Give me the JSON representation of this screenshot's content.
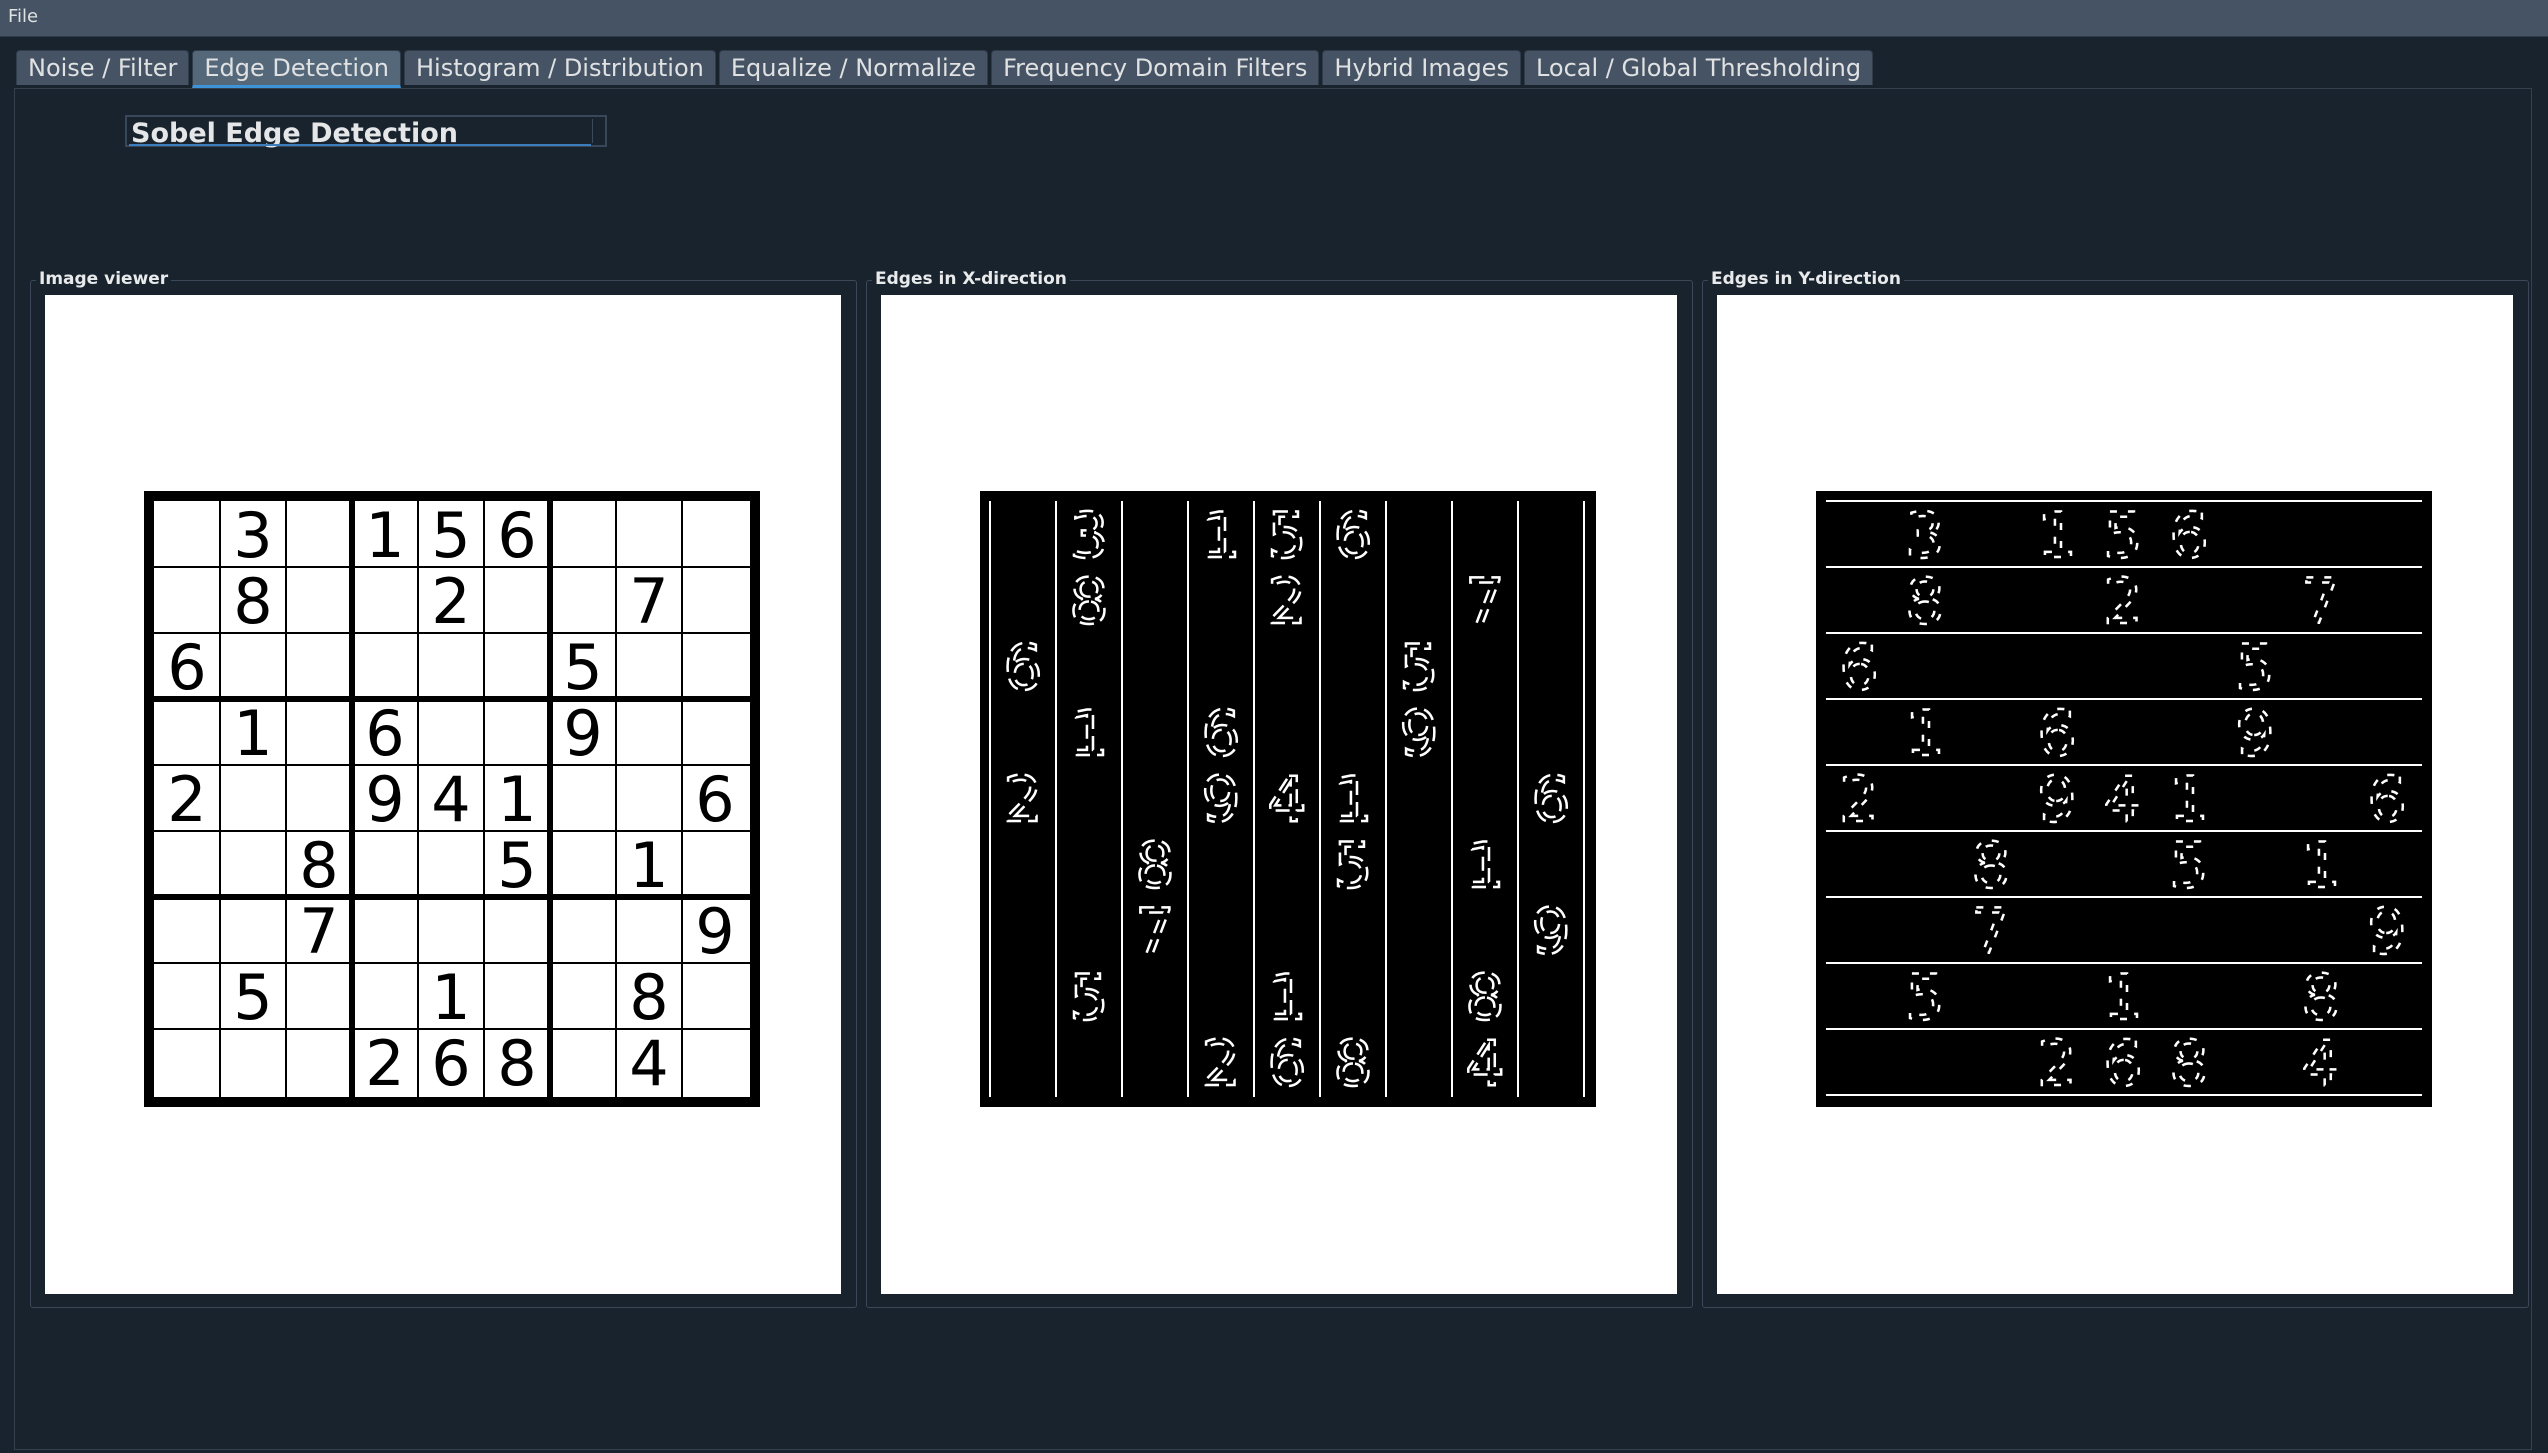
{
  "menubar": {
    "file_label": "File"
  },
  "tabs": [
    {
      "label": "Noise / Filter",
      "active": false
    },
    {
      "label": "Edge Detection",
      "active": true
    },
    {
      "label": "Histogram / Distribution",
      "active": false
    },
    {
      "label": "Equalize / Normalize",
      "active": false
    },
    {
      "label": "Frequency Domain Filters",
      "active": false
    },
    {
      "label": "Hybrid Images",
      "active": false
    },
    {
      "label": "Local / Global Thresholding",
      "active": false
    }
  ],
  "edge_detection": {
    "method_select": {
      "value": "Sobel Edge Detection"
    },
    "panels": [
      {
        "title": "Image viewer",
        "mode": "original"
      },
      {
        "title": "Edges in X-direction",
        "mode": "x"
      },
      {
        "title": "Edges in Y-direction",
        "mode": "y"
      }
    ],
    "sudoku_grid": [
      [
        "",
        "3",
        "",
        "1",
        "5",
        "6",
        "",
        "",
        ""
      ],
      [
        "",
        "8",
        "",
        "",
        "2",
        "",
        "",
        "7",
        ""
      ],
      [
        "6",
        "",
        "",
        "",
        "",
        "",
        "5",
        "",
        ""
      ],
      [
        "",
        "1",
        "",
        "6",
        "",
        "",
        "9",
        "",
        ""
      ],
      [
        "2",
        "",
        "",
        "9",
        "4",
        "1",
        "",
        "",
        "6"
      ],
      [
        "",
        "",
        "8",
        "",
        "",
        "5",
        "",
        "1",
        ""
      ],
      [
        "",
        "",
        "7",
        "",
        "",
        "",
        "",
        "",
        "9"
      ],
      [
        "",
        "5",
        "",
        "",
        "1",
        "",
        "",
        "8",
        ""
      ],
      [
        "",
        "",
        "",
        "2",
        "6",
        "8",
        "",
        "4",
        ""
      ]
    ]
  },
  "colors": {
    "background": "#19232d",
    "tab": "#455364",
    "tab_active": "#54687a",
    "accent": "#3d94d8"
  }
}
